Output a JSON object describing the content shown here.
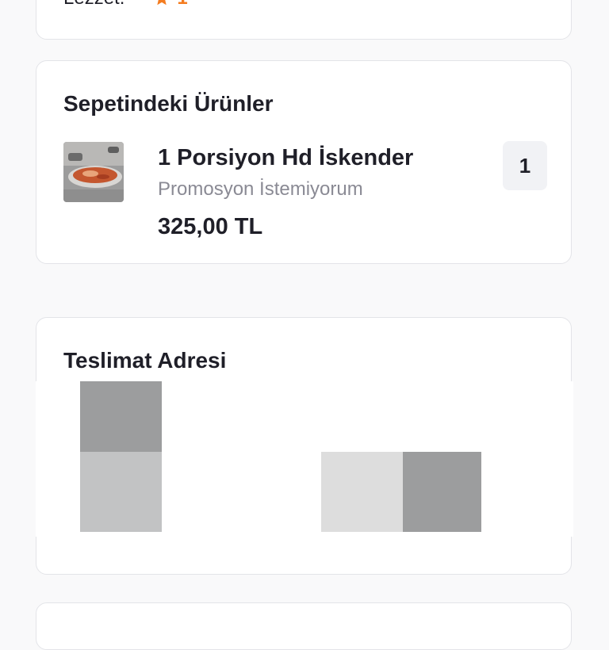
{
  "rating": {
    "label": "Lezzet:",
    "value": "1",
    "star_icon": "star-icon",
    "accent": "#f47c20"
  },
  "basket": {
    "title": "Sepetindeki Ürünler",
    "items": [
      {
        "name": "1 Porsiyon Hd İskender",
        "option": "Promosyon İstemiyorum",
        "price": "325,00 TL",
        "quantity": "1",
        "image": "food-image"
      }
    ]
  },
  "address": {
    "title": "Teslimat Adresi"
  }
}
